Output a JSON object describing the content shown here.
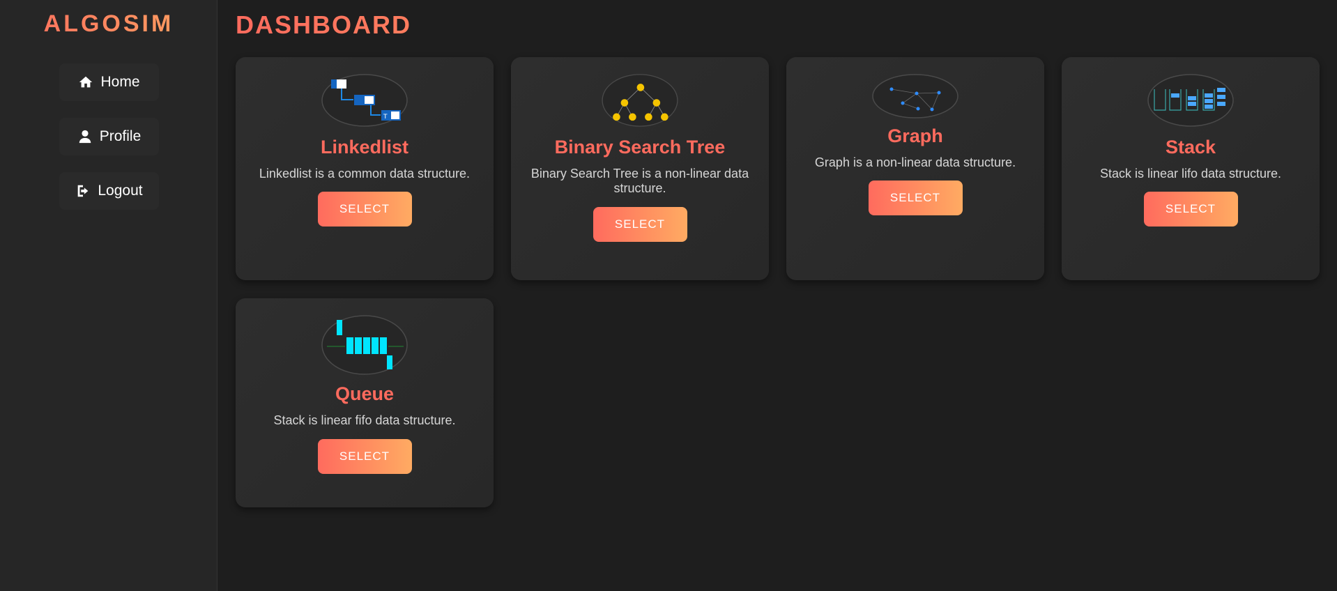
{
  "app": {
    "name": "ALGOSIM"
  },
  "sidebar": {
    "items": [
      {
        "label": "Home",
        "icon": "home-icon"
      },
      {
        "label": "Profile",
        "icon": "user-icon"
      },
      {
        "label": "Logout",
        "icon": "logout-icon"
      }
    ]
  },
  "main": {
    "title": "DASHBOARD",
    "cards": [
      {
        "title": "Linkedlist",
        "description": "Linkedlist is a common data structure.",
        "button": "SELECT",
        "thumbnail": "linkedlist-diagram"
      },
      {
        "title": "Binary Search Tree",
        "description": "Binary Search Tree is a non-linear data structure.",
        "button": "SELECT",
        "thumbnail": "bst-diagram"
      },
      {
        "title": "Graph",
        "description": "Graph is a non-linear data structure.",
        "button": "SELECT",
        "thumbnail": "graph-diagram"
      },
      {
        "title": "Stack",
        "description": "Stack is linear lifo data structure.",
        "button": "SELECT",
        "thumbnail": "stack-diagram"
      },
      {
        "title": "Queue",
        "description": "Stack is linear fifo data structure.",
        "button": "SELECT",
        "thumbnail": "queue-diagram"
      }
    ]
  },
  "colors": {
    "accent": "#ff6b5e",
    "accent_gradient_end": "#ffab62",
    "background": "#1e1e1e",
    "sidebar": "#262626",
    "card": "#2e2e2e"
  }
}
